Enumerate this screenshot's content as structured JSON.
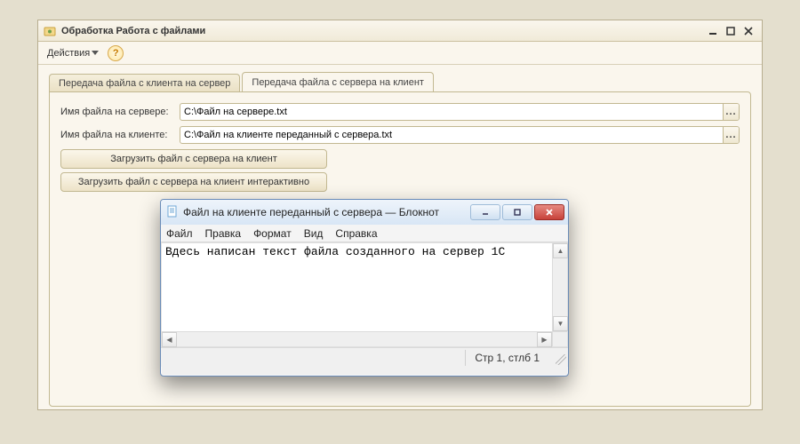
{
  "window": {
    "title": "Обработка  Работа с файлами"
  },
  "toolbar": {
    "actions_label": "Действия"
  },
  "tabs": {
    "tab1": "Передача файла с клиента на сервер",
    "tab2": "Передача файла с сервера на клиент"
  },
  "form": {
    "server_label": "Имя файла на сервере:",
    "server_value": "C:\\Файл на сервере.txt",
    "client_label": "Имя файла на клиенте:",
    "client_value": "C:\\Файл на клиенте переданный с сервера.txt",
    "btn1": "Загрузить файл с сервера на клиент",
    "btn2": "Загрузить файл с сервера на клиент интерактивно",
    "dots": "..."
  },
  "notepad": {
    "title": "Файл на клиенте переданный с сервера — Блокнот",
    "menu": {
      "file": "Файл",
      "edit": "Правка",
      "format": "Формат",
      "view": "Вид",
      "help": "Справка"
    },
    "content": "Вдесь написан текст файла созданного на сервер 1С",
    "status": "Стр 1, стлб 1"
  }
}
